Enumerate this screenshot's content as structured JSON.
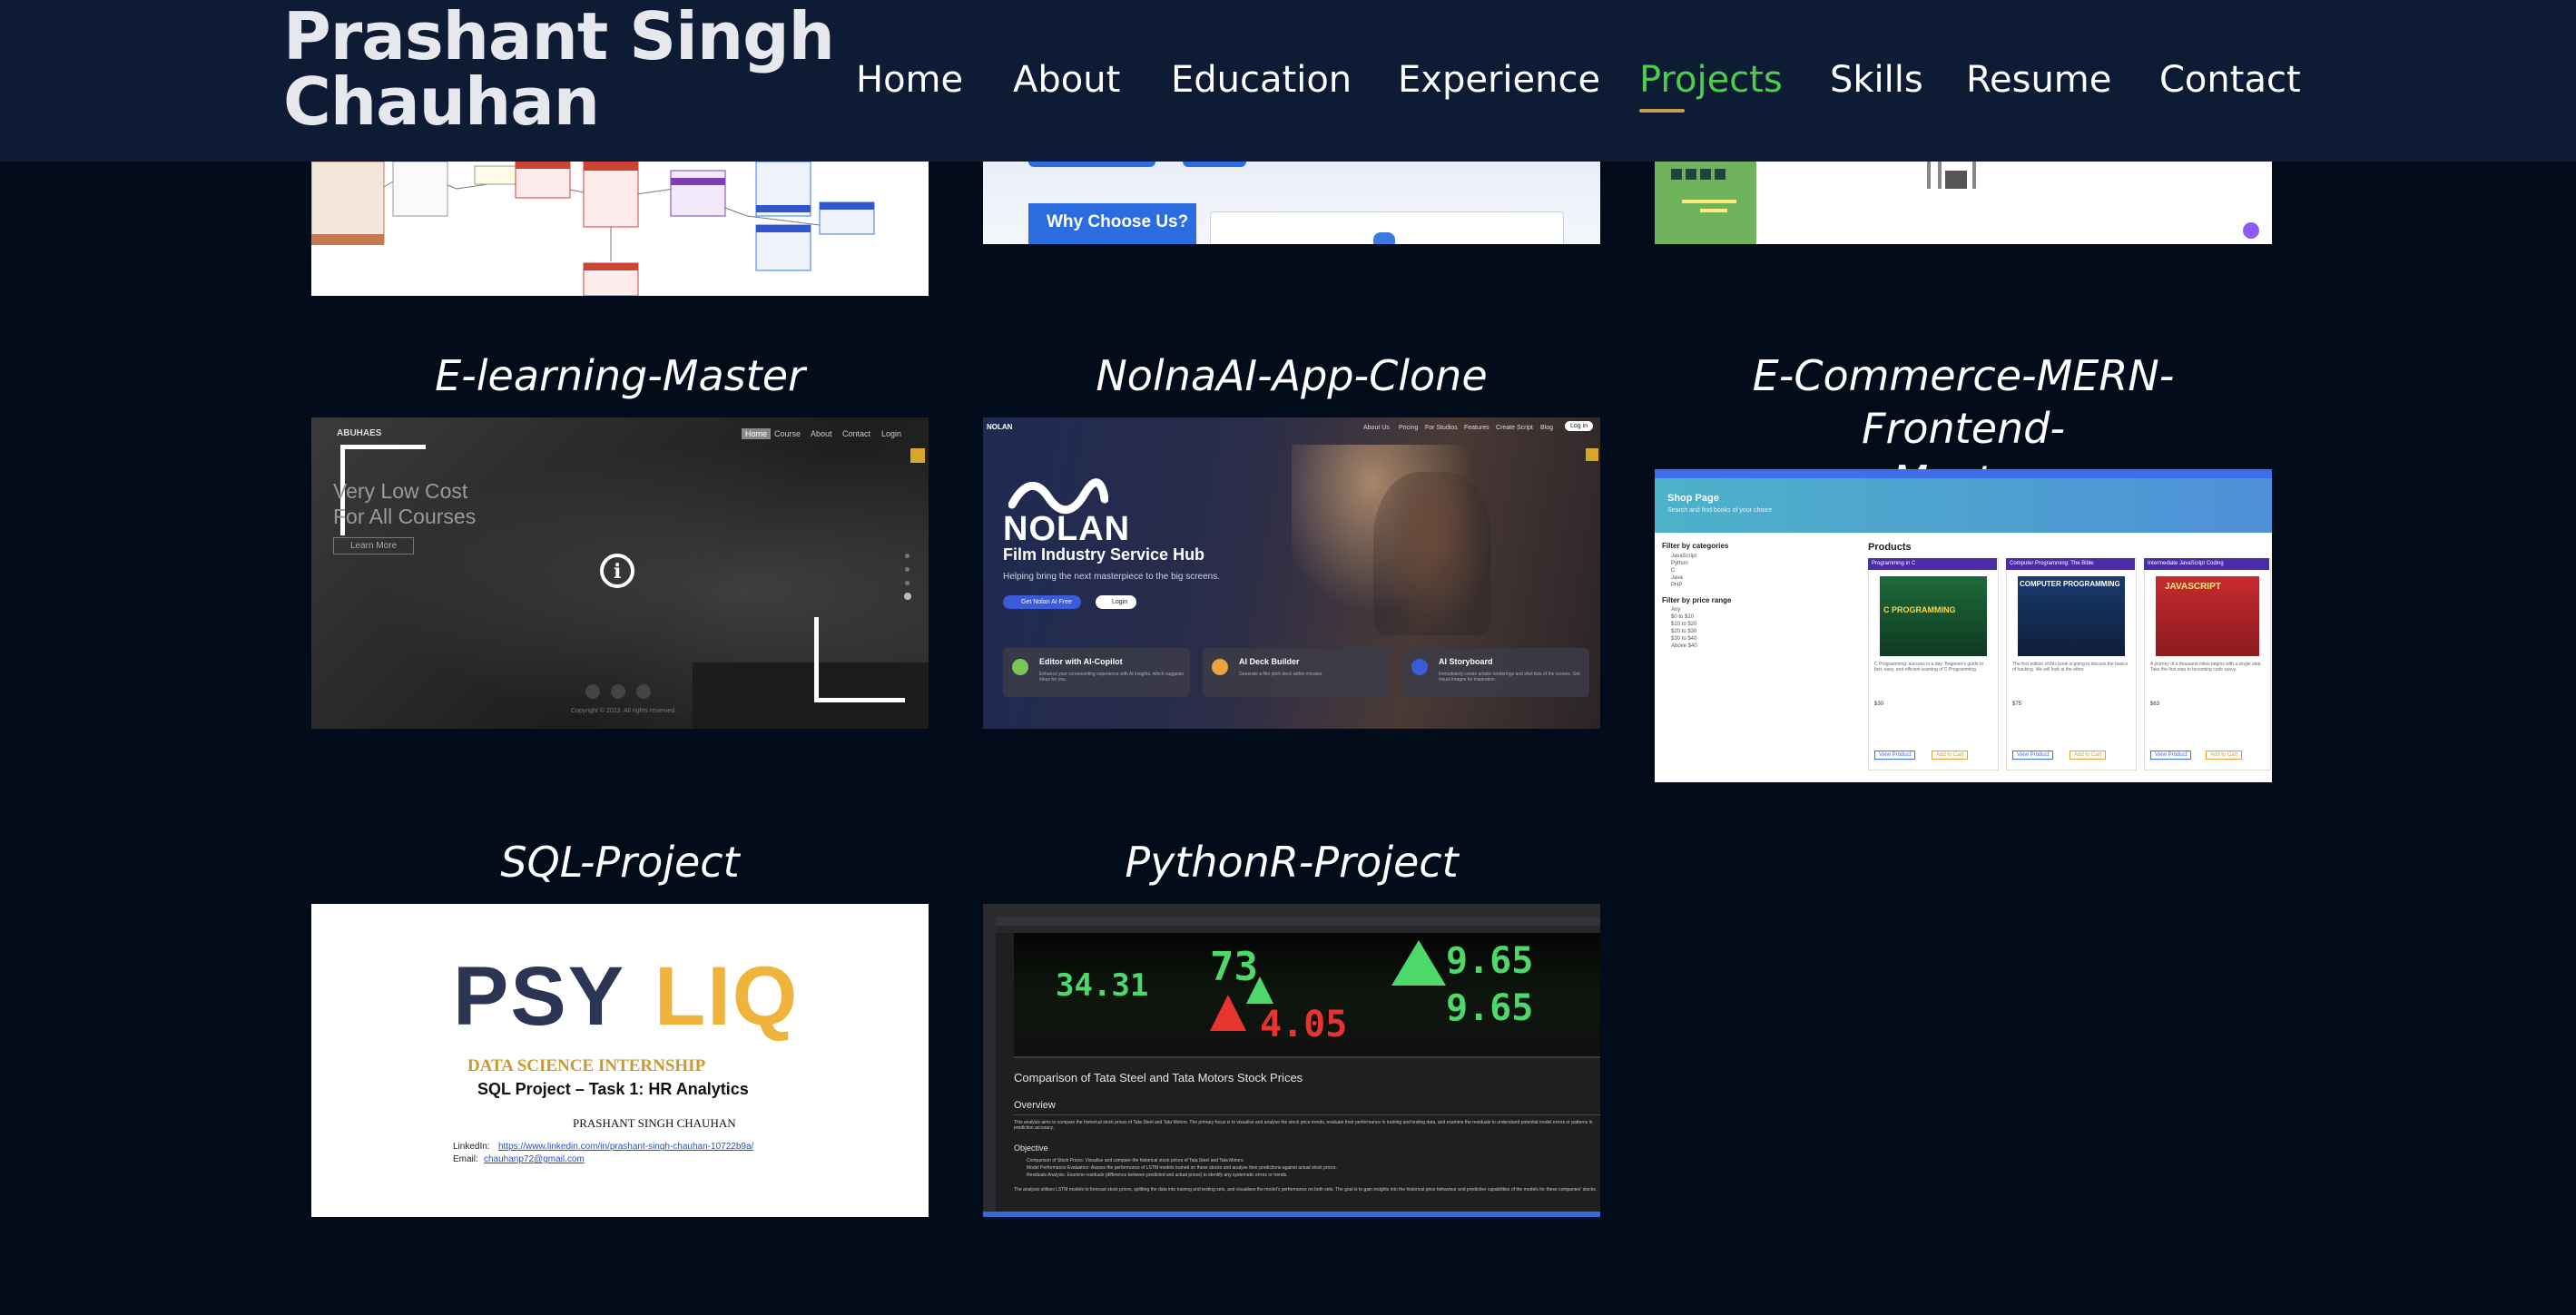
{
  "header": {
    "brand_line1": "Prashant Singh",
    "brand_line2": "Chauhan",
    "nav": [
      "Home",
      "About",
      "Education",
      "Experience",
      "Projects",
      "Skills",
      "Resume",
      "Contact"
    ],
    "active": "Projects"
  },
  "projects": {
    "top_partial": {
      "why_choose": "Why Choose Us?"
    },
    "elearning": {
      "title": "E-learning-Master",
      "brand": "ABUHAES",
      "nav": [
        "Home",
        "Course",
        "About",
        "Contact",
        "Login"
      ],
      "hero_line1": "Very Low Cost",
      "hero_line2": "For All Courses",
      "cta": "Learn More",
      "footer": "Copyright © 2023. All rights reserved."
    },
    "nolna": {
      "title": "NolnaAI-App-Clone",
      "logo": "NOLAN",
      "nav": [
        "About Us",
        "Pricing",
        "For Studios",
        "Features",
        "Create Script",
        "Blog"
      ],
      "login": "Log in",
      "hero_title": "Film Industry Service Hub",
      "hero_sub": "Helping bring the next masterpiece to the big screens.",
      "btn_primary": "Get Nolan AI Free",
      "btn_secondary": "Login",
      "features": [
        {
          "title": "Editor with AI-Copilot",
          "desc": "Enhance your screenwriting experience with AI insights, which suggests ideas for you."
        },
        {
          "title": "AI Deck Builder",
          "desc": "Generate a film pitch deck within minutes."
        },
        {
          "title": "AI Storyboard",
          "desc": "Immediately create artistic renderings and shot lists of the scenes. Get visual images for inspiration."
        }
      ]
    },
    "ecommerce": {
      "title": "E-Commerce-MERN-Frontend-Master",
      "title_line1": "E-Commerce-MERN-Frontend-",
      "title_line2": "Master",
      "banner_title": "Shop Page",
      "banner_sub": "Search and find books of your choice",
      "filter_cat": "Filter by categories",
      "cats": [
        "JavaScript",
        "Python",
        "C",
        "Java",
        "PHP"
      ],
      "filter_price": "Filter by price range",
      "prices": [
        "Any",
        "$0 to $10",
        "$10 to $20",
        "$20 to $30",
        "$30 to $40",
        "Above $40"
      ],
      "products_heading": "Products",
      "books": [
        {
          "tag": "Programming in C",
          "cover": "C PROGRAMMING",
          "color": "#1f6b3a",
          "price": "$30",
          "desc": "C Programming: success in a day: Beginner's guide to fast, easy, and efficient learning of C Programming."
        },
        {
          "tag": "Computer Programming: The Bible",
          "cover": "COMPUTER PROGRAMMING",
          "color": "#1a3a6e",
          "price": "$75",
          "desc": "The first edition of this book is going to discuss the basics of hacking. We will look at the other."
        },
        {
          "tag": "Intermediate JavaScript Coding",
          "cover": "JAVASCRIPT",
          "color": "#b8242a",
          "price": "$63",
          "desc": "A journey of a thousand miles begins with a single step. Take the first step to becoming code savvy."
        }
      ],
      "btn_view": "View Product",
      "btn_cart": "Add to Cart"
    },
    "sql": {
      "title": "SQL-Project",
      "logo_a": "PSY",
      "logo_b": "LIQ",
      "internship": "DATA SCIENCE INTERNSHIP",
      "task": "SQL Project – Task 1: HR Analytics",
      "author": "PRASHANT SINGH CHAUHAN",
      "linkedin_label": "LinkedIn:",
      "linkedin_url": "https://www.linkedin.com/in/prashant-singh-chauhan-10722b9a/",
      "email_label": "Email:",
      "email": "chauhanp72@gmail.com"
    },
    "pythonr": {
      "title": "PythonR-Project",
      "heading": "Comparison of Tata Steel and Tata Motors Stock Prices",
      "overview": "Overview",
      "overview_text": "This analysis aims to compare the historical stock prices of Tata Steel and Tata Motors. The primary focus is to visualise and analyse the stock price trends, evaluate their performance in training and testing data, and examine the residuals to understand potential model errors or patterns in prediction accuracy.",
      "objective": "Objective",
      "bullets": [
        "Comparison of Stock Prices: Visualise and compare the historical stock prices of Tata Steel and Tata Motors.",
        "Model Performance Evaluation: Assess the performance of LSTM models trained on these stocks and analyse their predictions against actual stock prices.",
        "Residuals Analysis: Examine residuals (difference between predicted and actual prices) to identify any systematic errors or trends."
      ],
      "footer_text": "The analysis utilises LSTM models to forecast stock prices, splitting the data into training and testing sets, and visualises the model's performance on both sets. The goal is to gain insights into the historical price behaviour and predictive capabilities of the models for these companies' stocks.",
      "ticker_numbers": [
        "34.31",
        "73",
        "9.65",
        "4.05",
        "9.65"
      ]
    }
  }
}
